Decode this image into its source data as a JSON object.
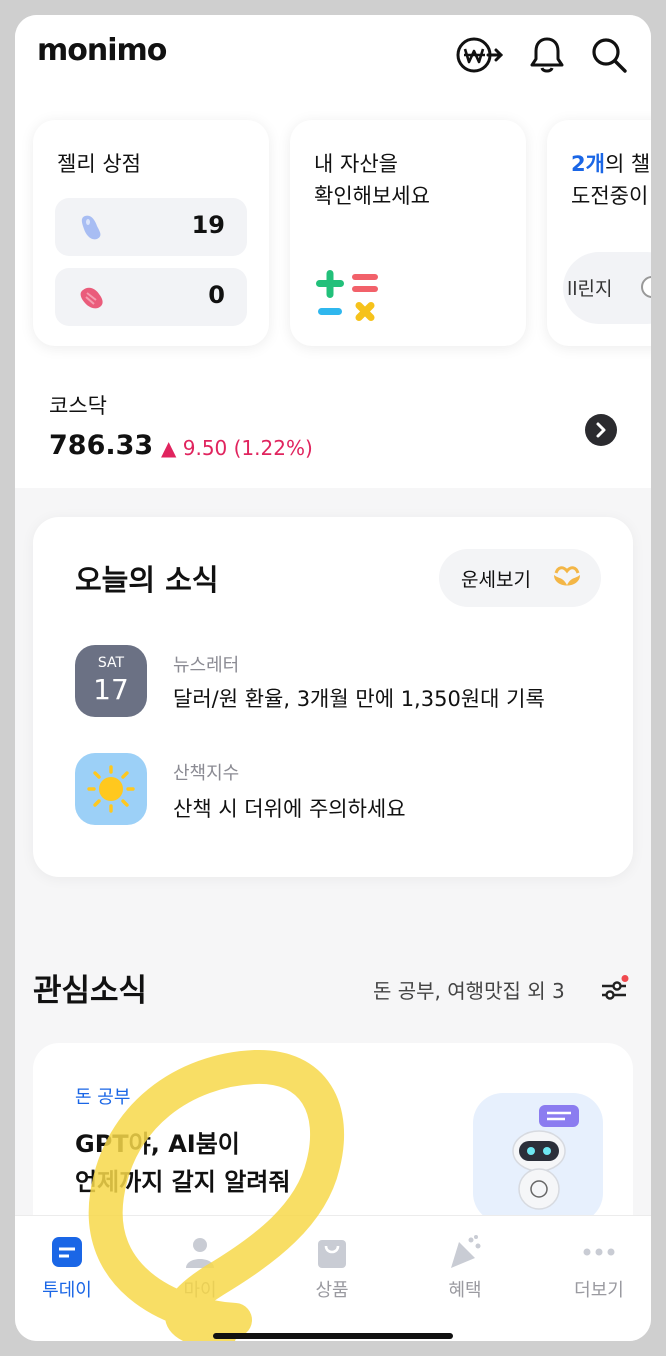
{
  "header": {
    "logo": "monimo",
    "icons": [
      "won-exchange-icon",
      "bell-icon",
      "search-icon"
    ]
  },
  "cards": [
    {
      "title": "젤리 상점",
      "rows": [
        {
          "icon": "blue-jelly-icon",
          "value": "19"
        },
        {
          "icon": "pink-jelly-icon",
          "value": "0"
        }
      ]
    },
    {
      "title_line1": "내 자산을",
      "title_line2": "확인해보세요",
      "icon": "calculator-symbols-icon"
    },
    {
      "title_prefix": "2개",
      "title_suffix": "의 챌",
      "title_line2": "도전중이",
      "chip_text": "ll린지"
    }
  ],
  "stock": {
    "name": "코스닥",
    "value": "786.33",
    "change": "▲ 9.50 (1.22%)"
  },
  "news": {
    "title": "오늘의 소식",
    "fortune_label": "운세보기",
    "items": [
      {
        "date_day": "SAT",
        "date_num": "17",
        "category": "뉴스레터",
        "text": "달러/원 환율, 3개월 만에 1,350원대 기록"
      },
      {
        "category": "산책지수",
        "text": "산책 시 더위에 주의하세요"
      }
    ]
  },
  "interest": {
    "title": "관심소식",
    "tags": "돈 공부, 여행맛집 외 3",
    "card": {
      "category": "돈 공부",
      "title_line1": "GPT야, AI붐이",
      "title_line2": "언제까지 갈지 알려줘"
    }
  },
  "nav": [
    {
      "label": "투데이",
      "active": true
    },
    {
      "label": "마이",
      "active": false
    },
    {
      "label": "상품",
      "active": false
    },
    {
      "label": "혜택",
      "active": false
    },
    {
      "label": "더보기",
      "active": false
    }
  ],
  "colors": {
    "accent": "#1a66e6",
    "stock_up": "#e0245e",
    "highlight_scribble": "#f7d84a"
  }
}
